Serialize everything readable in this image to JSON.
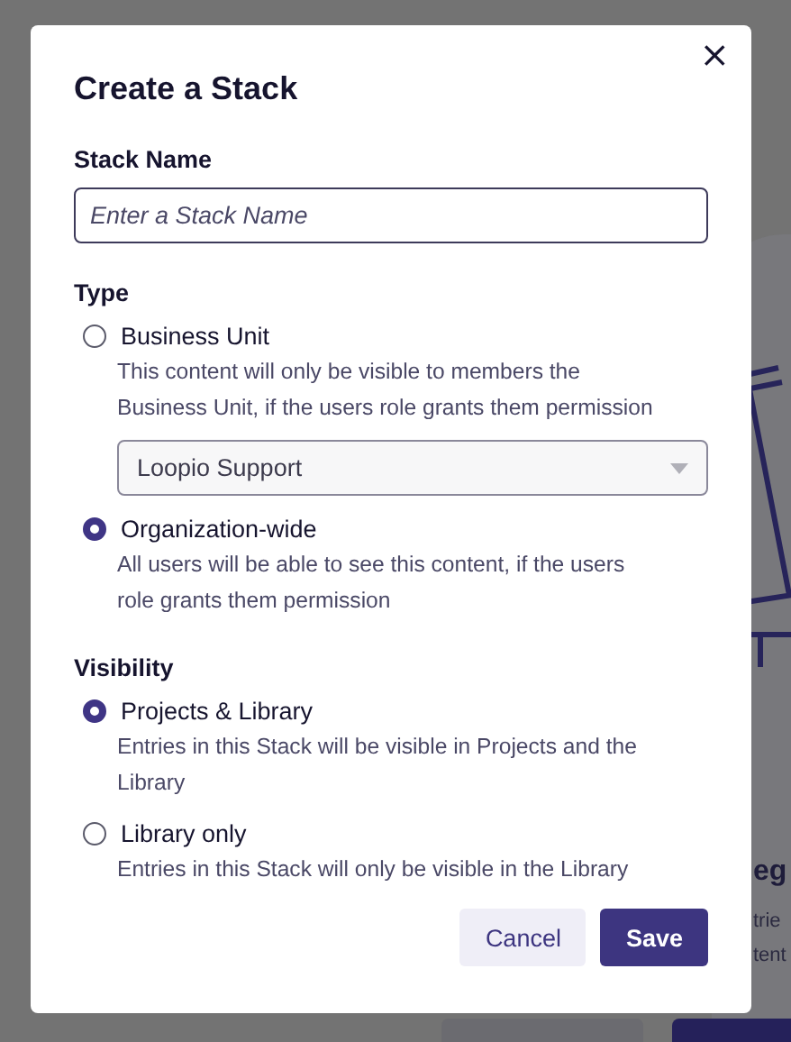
{
  "background": {
    "heading": "eg",
    "lines": [
      "trie",
      "tent"
    ],
    "buttons": [
      {
        "kind": "secondary"
      },
      {
        "kind": "primary"
      }
    ]
  },
  "dialog": {
    "title": "Create a Stack",
    "close": "×",
    "stack_name": {
      "label": "Stack Name",
      "placeholder": "Enter a Stack Name"
    },
    "type": {
      "label": "Type",
      "options": [
        {
          "label": "Business Unit",
          "description": "This content will only be visible to members the Business Unit, if the users role grants them permission",
          "selected": false,
          "select": {
            "value": "Loopio Support"
          }
        },
        {
          "label": "Organization-wide",
          "description": "All users will be able to see this content, if the users role grants them permission",
          "selected": true
        }
      ]
    },
    "visibility": {
      "label": "Visibility",
      "options": [
        {
          "label": "Projects & Library",
          "description": "Entries in this Stack will be visible in Projects and the Library",
          "selected": true
        },
        {
          "label": "Library only",
          "description": "Entries in this Stack will only be visible in the Library",
          "selected": false
        }
      ]
    },
    "buttons": [
      {
        "label": "Cancel",
        "kind": "secondary"
      },
      {
        "label": "Save",
        "kind": "primary"
      }
    ]
  }
}
